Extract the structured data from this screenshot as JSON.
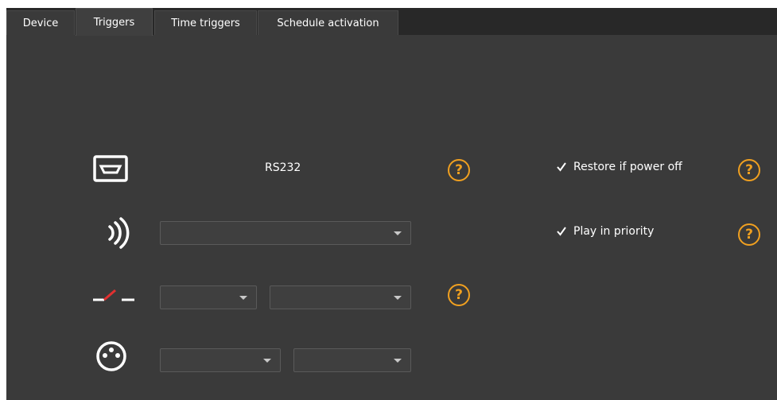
{
  "tabs": [
    {
      "label": "Device"
    },
    {
      "label": "Triggers"
    },
    {
      "label": "Time triggers"
    },
    {
      "label": "Schedule activation"
    }
  ],
  "active_tab": "Triggers",
  "triggers": {
    "rs232_label": "RS232",
    "restore_label": "Restore if power off",
    "restore_checked": true,
    "priority_label": "Play in priority",
    "priority_checked": true,
    "help_glyph": "?",
    "ir_select_value": "",
    "contact_select_1_value": "",
    "contact_select_2_value": "",
    "dmx_select_1_value": "",
    "dmx_select_2_value": ""
  },
  "icons": {
    "rs232": "serial-port-icon",
    "ir": "infrared-icon",
    "contact": "dry-contact-switch-icon",
    "dmx": "dmx-connector-icon",
    "help": "help-icon"
  },
  "colors": {
    "accent": "#f0a020",
    "switch_red": "#e03030",
    "background": "#3a3a3a"
  }
}
